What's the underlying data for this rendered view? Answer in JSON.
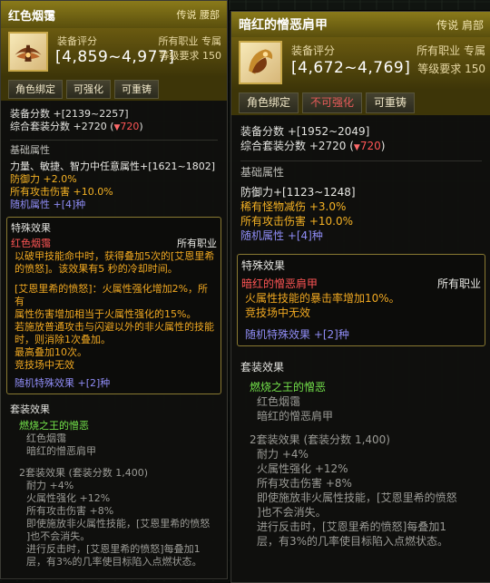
{
  "left": {
    "title": "红色烟霭",
    "tags": "传说 腰部",
    "eval_label": "装备评分",
    "score": "[4,859~4,977]",
    "class": "所有职业 专属",
    "level": "等级要求 150",
    "buttons": [
      "角色绑定",
      "可强化",
      "可重铸"
    ],
    "equip_score": "装备分数 +[2139~2257]",
    "set_score_prefix": "综合套装分数 +2720 (",
    "set_score_delta": "720",
    "set_score_suffix": ")",
    "basic_title": "基础属性",
    "basic_line1": "力量、敏捷、智力中任意属性+[1621~1802]",
    "def": "防御力 +2.0%",
    "atk": "所有攻击伤害 +10.0%",
    "random_attr": "随机属性 +[4]种",
    "special_title": "特殊效果",
    "special_name": "红色烟霭",
    "special_class": "所有职业",
    "special_desc": [
      "以破甲技能命中时，获得叠加5次的[艾恩里希",
      "的愤怒]。该效果有5 秒的冷却时间。",
      "",
      "[艾恩里希的愤怒]：火属性强化增加2%，所有",
      "属性伤害增加相当于火属性强化的15%。",
      "若施放普通攻击与闪避以外的非火属性的技能",
      "时，则消除1次叠加。",
      "最高叠加10次。",
      "竞技场中无效"
    ],
    "random_special": "随机特殊效果 +[2]种",
    "set_title": "套装效果",
    "set_name": "燃烧之王的憎恶",
    "set_items": [
      "红色烟霭",
      "暗红的憎恶肩甲"
    ],
    "set2_title": "2套装效果 (套装分数 1,400)",
    "set2_lines": [
      "耐力 +4%",
      "火属性强化 +12%",
      "所有攻击伤害 +8%",
      "即使施放非火属性技能，[艾恩里希的愤怒",
      "]也不会消失。",
      "进行反击时，[艾恩里希的愤怒]每叠加1",
      "层，有3%的几率使目标陷入点燃状态。"
    ]
  },
  "right": {
    "title": "暗红的憎恶肩甲",
    "tags": "传说 肩部",
    "eval_label": "装备评分",
    "score": "[4,672~4,769]",
    "class": "所有职业 专属",
    "level": "等级要求 150",
    "buttons": [
      "角色绑定",
      "不可强化",
      "可重铸"
    ],
    "equip_score": "装备分数 +[1952~2049]",
    "set_score_prefix": "综合套装分数 +2720 (",
    "set_score_delta": "720",
    "set_score_suffix": ")",
    "basic_title": "基础属性",
    "def": "防御力+[1123~1248]",
    "rare": "稀有怪物减伤 +3.0%",
    "atk": "所有攻击伤害 +10.0%",
    "random_attr": "随机属性 +[4]种",
    "special_title": "特殊效果",
    "special_name": "暗红的憎恶肩甲",
    "special_class": "所有职业",
    "special_desc": [
      "火属性技能的暴击率增加10%。",
      "竞技场中无效"
    ],
    "random_special": "随机特殊效果 +[2]种",
    "set_title": "套装效果",
    "set_name": "燃烧之王的憎恶",
    "set_items": [
      "红色烟霭",
      "暗红的憎恶肩甲"
    ],
    "set2_title": "2套装效果 (套装分数 1,400)",
    "set2_lines": [
      "耐力 +4%",
      "火属性强化 +12%",
      "所有攻击伤害 +8%",
      "即使施放非火属性技能，[艾恩里希的愤怒",
      "]也不会消失。",
      "进行反击时，[艾恩里希的愤怒]每叠加1",
      "层，有3%的几率使目标陷入点燃状态。"
    ]
  }
}
